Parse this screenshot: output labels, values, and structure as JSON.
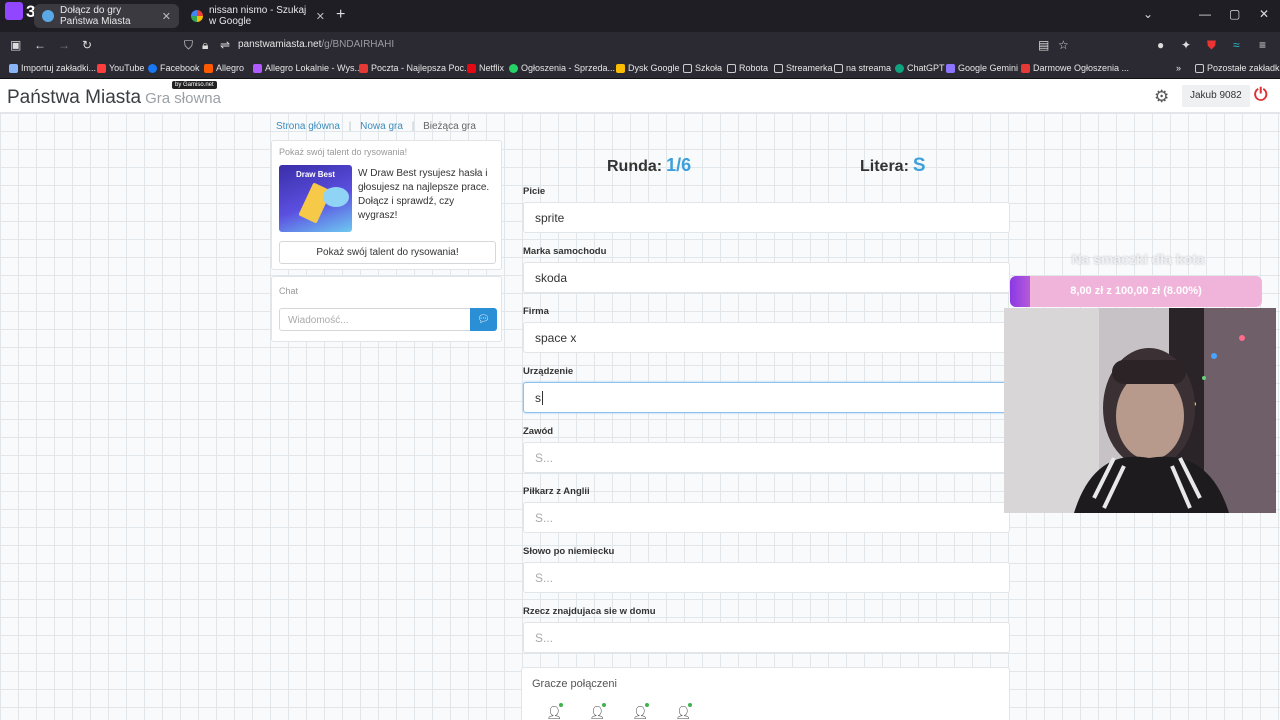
{
  "browser": {
    "stream_badge": "3",
    "tabs": [
      {
        "title": "Dołącz do gry Państwa Miasta",
        "active": true
      },
      {
        "title": "nissan nismo - Szukaj w Google",
        "active": false
      }
    ],
    "url_host": "panstwamiasta.net",
    "url_path": "/g/BNDAIRHAHI",
    "bookmarks": [
      "Importuj zakładki...",
      "YouTube",
      "Facebook",
      "Allegro",
      "Allegro Lokalnie - Wys...",
      "Poczta - Najlepsza Poc...",
      "Netflix",
      "Ogłoszenia - Sprzeda...",
      "Dysk Google",
      "Szkoła",
      "Robota",
      "Streamerka",
      "na streama",
      "ChatGPT",
      "Google Gemini",
      "Darmowe Ogłoszenia ..."
    ],
    "other_bookmarks": "Pozostałe zakładki",
    "bookmark_colors": [
      "#8ab4f8",
      "#ff3d3d",
      "#1877f2",
      "#ff5a00",
      "#ff5a00",
      "#e53935",
      "#e50914",
      "#25d366",
      "#fbbc04",
      "#cfcfcf",
      "#cfcfcf",
      "#cfcfcf",
      "#cfcfcf",
      "#10a37f",
      "#8e75ff",
      "#e53935"
    ]
  },
  "site": {
    "brand": "Państwa Miasta",
    "brand_sub": "Gra słowna",
    "byline": "by Gamiso.net",
    "user": "Jakub 9082"
  },
  "breadcrumb": {
    "home": "Strona główna",
    "new_game": "Nowa gra",
    "current": "Bieżąca gra"
  },
  "promo": {
    "title": "Pokaż swój talent do rysowania!",
    "image_text": "Draw Best",
    "body": "W Draw Best rysujesz hasła i głosujesz na najlepsze prace. Dołącz i sprawdź, czy wygrasz!",
    "button": "Pokaż swój talent do rysowania!"
  },
  "chat": {
    "title": "Chat",
    "placeholder": "Wiadomość..."
  },
  "game": {
    "round_label": "Runda:",
    "round_value": "1/6",
    "letter_label": "Litera:",
    "letter_value": "S",
    "fields": [
      {
        "label": "Picie",
        "value": "sprite",
        "placeholder": ""
      },
      {
        "label": "Marka samochodu",
        "value": "skoda",
        "placeholder": ""
      },
      {
        "label": "Firma",
        "value": "space x",
        "placeholder": ""
      },
      {
        "label": "Urządzenie",
        "value": "s",
        "placeholder": ""
      },
      {
        "label": "Zawód",
        "value": "",
        "placeholder": "S..."
      },
      {
        "label": "Piłkarz z Anglii",
        "value": "",
        "placeholder": "S..."
      },
      {
        "label": "Słowo po niemiecku",
        "value": "",
        "placeholder": "S..."
      },
      {
        "label": "Rzecz znajdujaca sie w domu",
        "value": "",
        "placeholder": "S..."
      }
    ],
    "players_title": "Gracze połączeni",
    "players_online": 4
  },
  "overlay": {
    "donation_title": "Na smaczki dla kota",
    "donation_text": "8,00 zł z 100,00 zł (8.00%)",
    "donation_progress": 0.08
  }
}
